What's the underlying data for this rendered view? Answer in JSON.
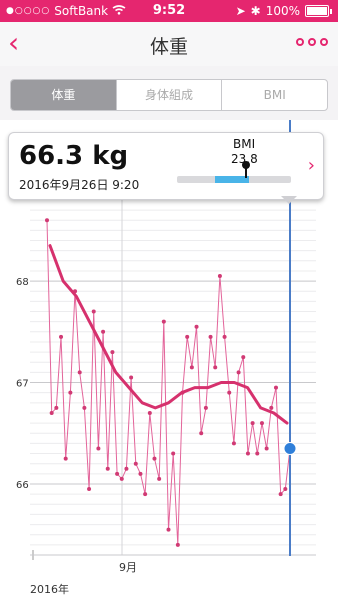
{
  "status_bar": {
    "carrier": "SoftBank",
    "time": "9:52",
    "battery": "100%",
    "signal_icon": "signal-dots-icon",
    "wifi_icon": "wifi-icon",
    "bluetooth_icon": "bluetooth-icon"
  },
  "navbar": {
    "title": "体重",
    "back_icon": "chevron-left-icon",
    "more_icon": "more-dots-icon"
  },
  "segments": [
    {
      "label": "体重",
      "selected": true
    },
    {
      "label": "身体組成",
      "selected": false
    },
    {
      "label": "BMI",
      "selected": false
    }
  ],
  "card": {
    "weight": "66.3 kg",
    "date": "2016年9月26日 9:20",
    "bmi_label": "BMI",
    "bmi_value": "23.8",
    "bmi_level": 0.6
  },
  "colors": {
    "accent": "#e5266f",
    "trend": "#d6316d",
    "points": "#e3649a",
    "cursor": "#4a7cc7",
    "bmi_fill": "#49b4e8"
  },
  "chart_data": {
    "type": "line",
    "y_ticks": [
      66,
      67,
      68
    ],
    "ylim": [
      65.3,
      68.75
    ],
    "x_tick_labels": [
      "9月"
    ],
    "x_extra_label": "2016年",
    "grid": true,
    "series": [
      {
        "values": [
          68.6,
          66.7,
          66.75,
          67.45,
          66.25,
          66.9,
          67.9,
          67.1,
          66.75,
          65.95,
          67.7,
          66.35,
          67.5,
          66.15,
          67.3,
          66.1,
          66.05,
          66.15,
          67.05,
          66.2,
          66.1,
          65.9,
          66.7,
          66.25,
          66.05,
          67.6,
          65.55,
          66.3,
          65.4,
          66.9,
          67.45,
          67.15,
          67.55,
          66.5,
          66.75,
          67.45,
          67.15,
          68.05,
          67.45,
          66.9,
          66.4,
          67.1,
          67.25,
          66.3,
          66.6,
          66.3,
          66.6,
          66.35,
          66.75,
          66.95,
          65.9,
          65.95,
          66.35
        ],
        "color": "points"
      },
      {
        "values": [
          68.35,
          68.0,
          67.85,
          67.6,
          67.35,
          67.1,
          66.95,
          66.8,
          66.75,
          66.8,
          66.9,
          66.95,
          66.95,
          67.0,
          67.0,
          66.95,
          66.75,
          66.7,
          66.6
        ],
        "color": "trend"
      }
    ]
  }
}
